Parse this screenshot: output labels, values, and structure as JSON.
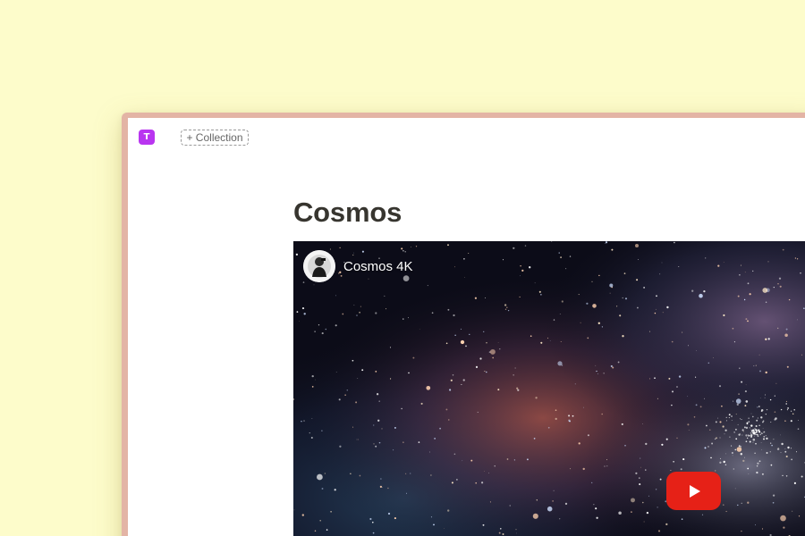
{
  "app": {
    "logo_letter": "T",
    "logo_color": "#b935f0",
    "add_collection_label": "+ Collection"
  },
  "page": {
    "title": "Cosmos"
  },
  "video": {
    "title": "Cosmos 4K",
    "play_icon": "youtube-play-icon",
    "play_color": "#e62117"
  },
  "colors": {
    "background": "#fdfccb",
    "frame": "#e3b4a5",
    "window": "#ffffff",
    "title_text": "#37352f"
  }
}
